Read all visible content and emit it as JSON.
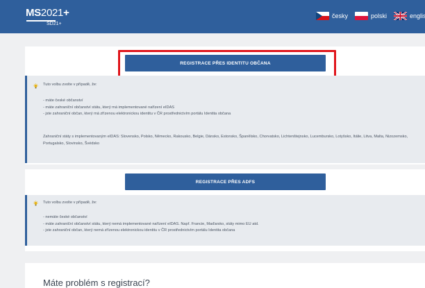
{
  "header": {
    "logo": {
      "ms": "MS",
      "year": "2021",
      "plus": "+",
      "sub": "SD21+"
    },
    "languages": [
      {
        "label": "česky",
        "flag": "cz-flag-icon"
      },
      {
        "label": "polski",
        "flag": "pl-flag-icon"
      },
      {
        "label": "english",
        "flag": "uk-flag-icon"
      }
    ]
  },
  "citizen_identity": {
    "button_label": "REGISTRACE PŘES IDENTITU OBČANA",
    "intro": "Tuto volbu zvolte v případě, že:",
    "conditions": [
      "- máte české občanství",
      "- máte zahraniční občanství státu, který má implementované nařízení eIDAS",
      "- jste zahraniční občan, který má zřízenou elektronickou identitu v ČR prostřednictvím portálu Identita občana"
    ],
    "eidas_states": "Zahraniční státy s implementovaným eIDAS: Slovensko, Polsko, Německo, Rakousko, Belgie, Dánsko, Estonsko, Španělsko, Chorvatsko, Lichtenštejnsko, Lucembursko, Lotyšsko, Itálie, Litva, Malta, Nizozemsko, Portugalsko, Slovinsko, Švédsko"
  },
  "adfs": {
    "button_label": "REGISTRACE PŘES ADFS",
    "intro": "Tuto volbu zvolte v případě, že:",
    "conditions": [
      "- nemáte české občanství",
      "- máte zahraniční občanství státu, který nemá implementované nařízení eIDAS. Např. Francie, Maďarsko, státy mimo EU atd.",
      "- jste zahraniční občan, který nemá zřízenou elektronickou identitu v ČR prostřednictvím portálu Identita občana"
    ]
  },
  "help": {
    "question": "Máte problém s registrací?"
  },
  "colors": {
    "header": "#2f5f9c",
    "button": "#2f5f9c",
    "highlight": "#e0151b",
    "info_bg": "#e8ebef"
  }
}
